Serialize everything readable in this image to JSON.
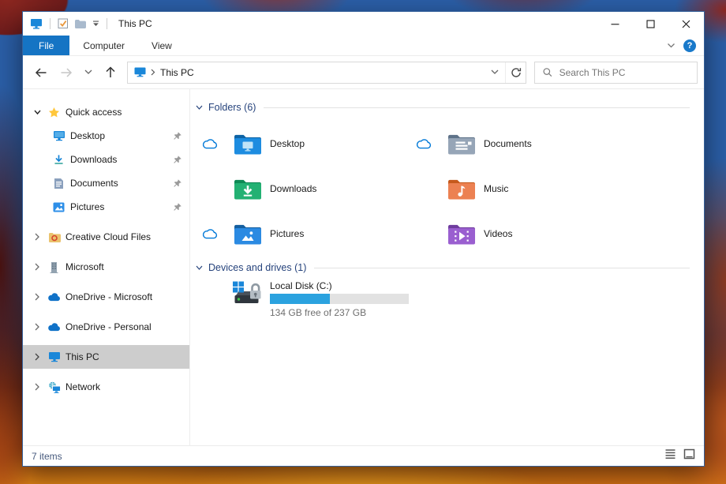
{
  "appearance": {
    "accent_blue": "#1574c4",
    "group_header_blue": "#26437c",
    "drive_bar_fill": "#2ba2df",
    "selected_sidebar_bg": "#cdcdcd",
    "sync_cloud_blue": "#0078d7"
  },
  "window": {
    "title": "This PC"
  },
  "ribbon": {
    "tabs": [
      {
        "label": "File",
        "active": true
      },
      {
        "label": "Computer",
        "active": false
      },
      {
        "label": "View",
        "active": false
      }
    ]
  },
  "navbar": {
    "breadcrumb": "This PC",
    "search_placeholder": "Search This PC"
  },
  "sidebar": {
    "quick_access": {
      "label": "Quick access"
    },
    "quick_items": [
      {
        "label": "Desktop",
        "pinned": true
      },
      {
        "label": "Downloads",
        "pinned": true
      },
      {
        "label": "Documents",
        "pinned": true
      },
      {
        "label": "Pictures",
        "pinned": true
      }
    ],
    "roots": [
      {
        "label": "Creative Cloud Files",
        "selected": false
      },
      {
        "label": "Microsoft",
        "selected": false
      },
      {
        "label": "OneDrive - Microsoft",
        "selected": false
      },
      {
        "label": "OneDrive - Personal",
        "selected": false
      },
      {
        "label": "This PC",
        "selected": true
      },
      {
        "label": "Network",
        "selected": false
      }
    ]
  },
  "content": {
    "folders_group_label": "Folders (6)",
    "folders": [
      {
        "name": "Desktop",
        "synced": true
      },
      {
        "name": "Downloads",
        "synced": false
      },
      {
        "name": "Pictures",
        "synced": true
      },
      {
        "name": "Documents",
        "synced": true
      },
      {
        "name": "Music",
        "synced": false
      },
      {
        "name": "Videos",
        "synced": false
      }
    ],
    "devices_group_label": "Devices and drives (1)",
    "drive": {
      "name": "Local Disk (C:)",
      "free_label": "134 GB free of 237 GB",
      "used_percent": 43
    }
  },
  "statusbar": {
    "items_count": "7 items"
  },
  "icons": {
    "this-pc": "blue-monitor",
    "properties": "checkbox-orange-check",
    "new-folder": "folder",
    "qat-dropdown": "overline-triangle-down",
    "back": "arrow-left",
    "forward": "arrow-right-disabled",
    "recent-locations": "chevron-down",
    "up": "arrow-up",
    "refresh": "circular-arrow",
    "search": "magnifier",
    "quick-access": "yellow-star",
    "pin": "pushpin",
    "onedrive": "blue-cloud",
    "sync-status": "outline-cloud",
    "help": "question-circle",
    "minimize-ribbon": "chevron-down",
    "view-details": "list-lines",
    "view-thumbnails": "framed-square",
    "local-disk": "hard-drive-windows-lock"
  }
}
